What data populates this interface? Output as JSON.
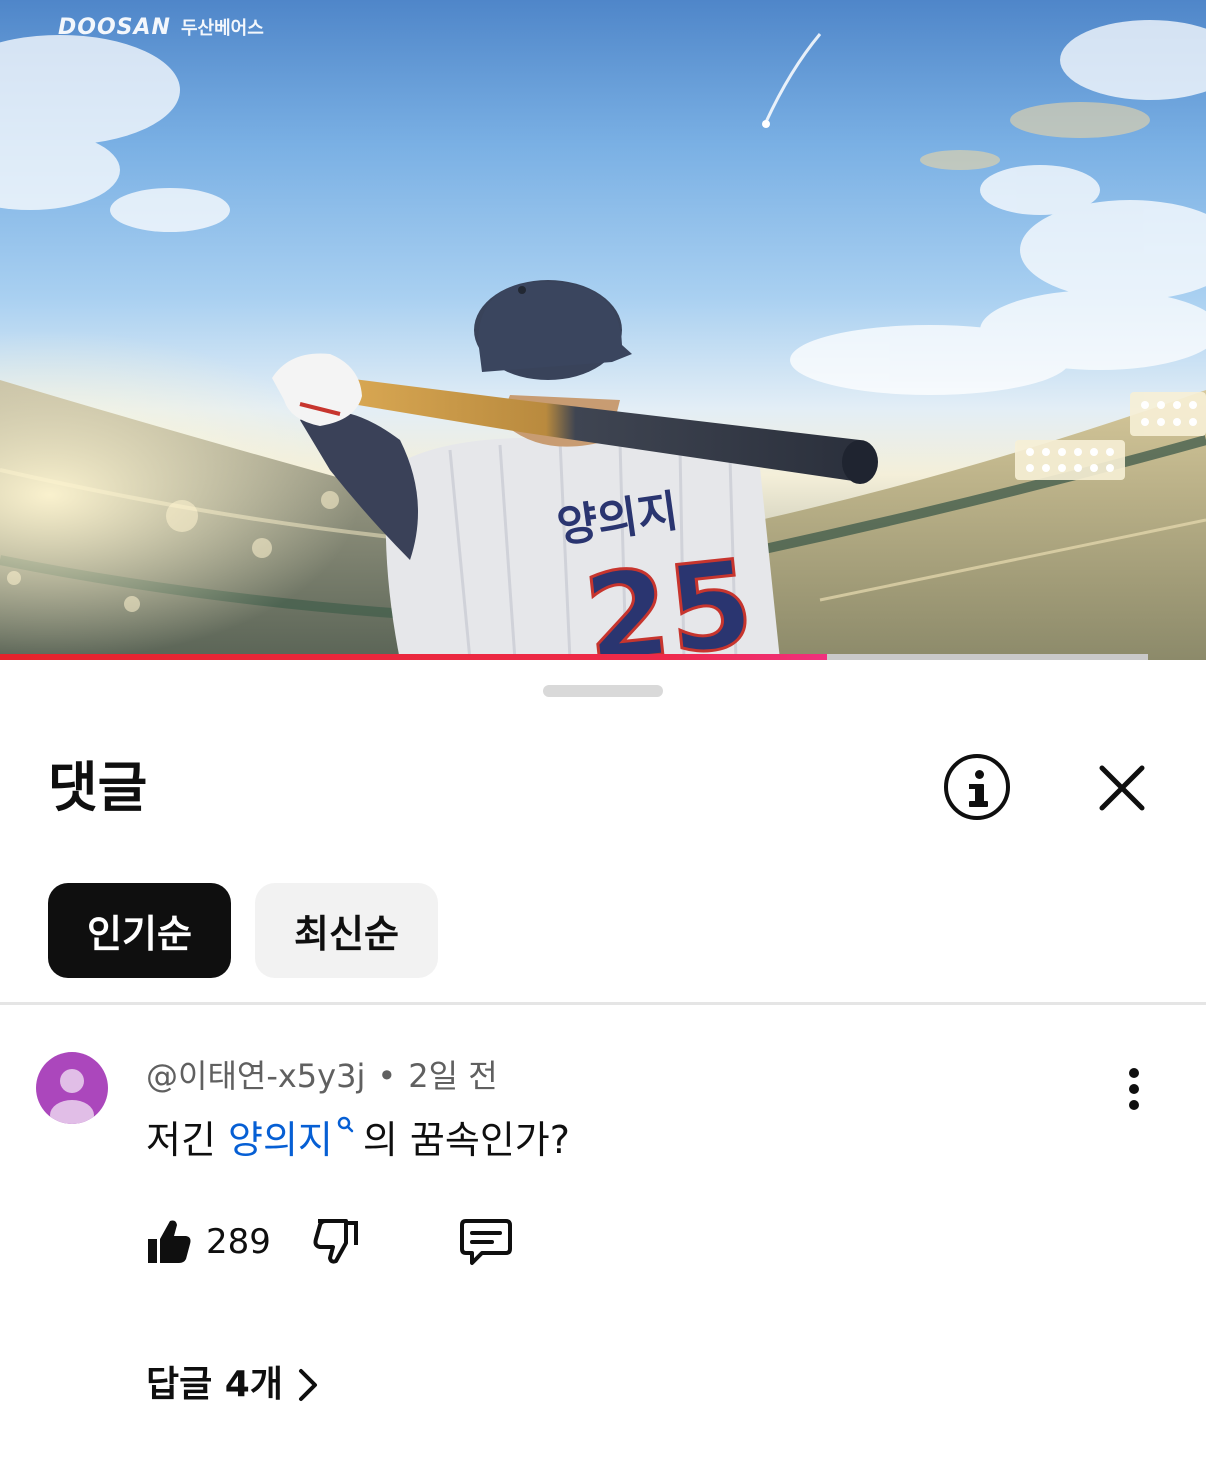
{
  "video": {
    "watermark_brand": "DOOSAN",
    "watermark_sub": "두산베어스",
    "jersey_name": "양의지",
    "jersey_number": "25",
    "progress_ratio": 0.72,
    "progress_colors": {
      "fill": "#e5232b",
      "track": "#c9c9c9"
    }
  },
  "sheet": {
    "title": "댓글",
    "info_icon": "info-circle-icon",
    "close_icon": "close-icon",
    "sort_tabs": [
      {
        "label": "인기순",
        "selected": true
      },
      {
        "label": "최신순",
        "selected": false
      }
    ]
  },
  "comment": {
    "author": "@이태연-x5y3j",
    "separator": "•",
    "time": "2일 전",
    "text_before": "저긴 ",
    "link_text": "양의지",
    "text_after": "의 꿈속인가?",
    "like_count": "289",
    "avatar_color": "#ab47bc",
    "link_color": "#065fd4",
    "replies_label": "답글 4개"
  }
}
